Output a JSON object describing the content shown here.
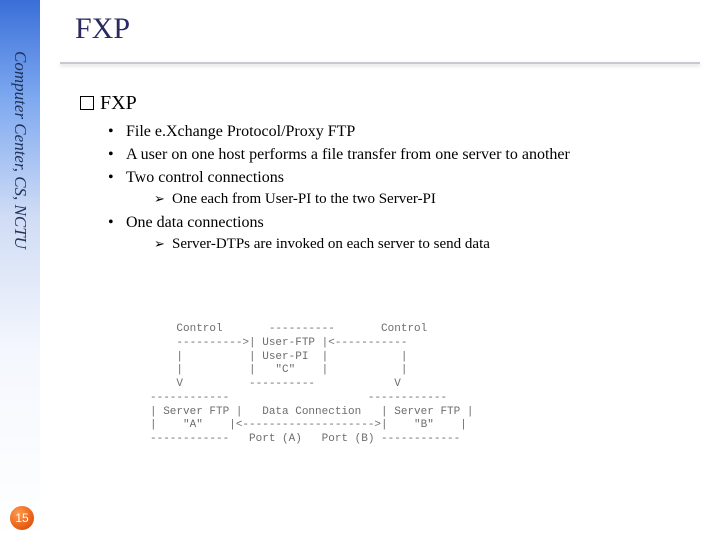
{
  "sidebar": {
    "label": "Computer Center, CS, NCTU",
    "page_number": "15"
  },
  "title": "FXP",
  "section": {
    "heading": "FXP",
    "bullets": [
      {
        "text": "File e.Xchange Protocol/Proxy FTP"
      },
      {
        "text": "A user on one host performs a file transfer from one server to another"
      },
      {
        "text": "Two control connections",
        "sub": [
          "One each from User-PI to the two Server-PI"
        ]
      },
      {
        "text": "One data connections",
        "sub": [
          "Server-DTPs are invoked on each server to send data"
        ]
      }
    ]
  },
  "diagram": "    Control       ----------       Control\n    ---------->| User-FTP |<-----------\n    |          | User-PI  |           |\n    |          |   \"C\"    |           |\n    V          ----------            V\n------------                     ------------\n| Server FTP |   Data Connection   | Server FTP |\n|    \"A\"    |<-------------------->|    \"B\"    |\n------------   Port (A)   Port (B) ------------"
}
